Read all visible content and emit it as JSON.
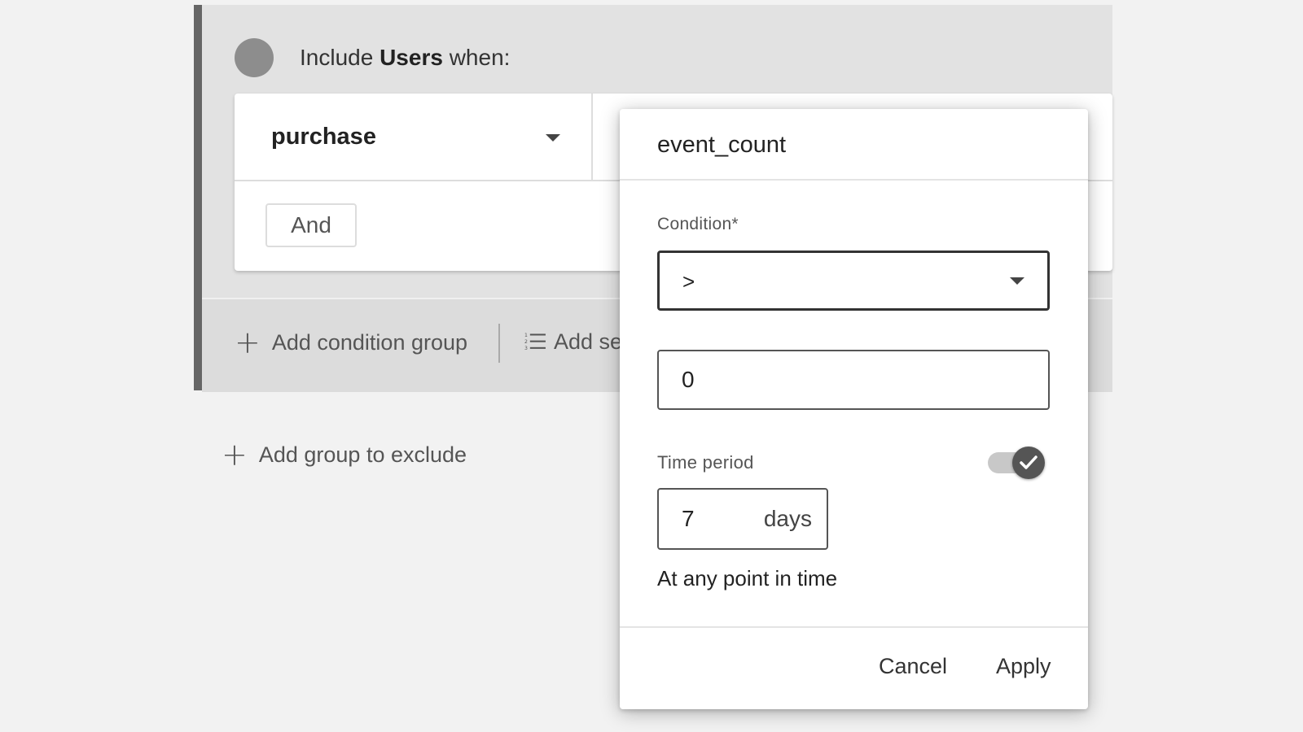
{
  "group": {
    "title_prefix": "Include",
    "title_bold": "Users",
    "title_suffix": "when:"
  },
  "condition": {
    "event_name": "purchase",
    "and_label": "And"
  },
  "actions": {
    "add_condition_group": "Add condition group",
    "add_sequence_partial": "Add se",
    "add_group_to_exclude": "Add group to exclude"
  },
  "popup": {
    "title": "event_count",
    "condition_label": "Condition*",
    "condition_value": ">",
    "value_input": "0",
    "time_period_label": "Time period",
    "time_period_enabled": true,
    "period_value": "7",
    "period_unit": "days",
    "any_point_text": "At any point in time",
    "cancel_label": "Cancel",
    "apply_label": "Apply"
  },
  "icons": {
    "plus": "plus-icon",
    "list": "numbered-list-icon",
    "caret": "chevron-down-icon",
    "check": "check-icon"
  }
}
